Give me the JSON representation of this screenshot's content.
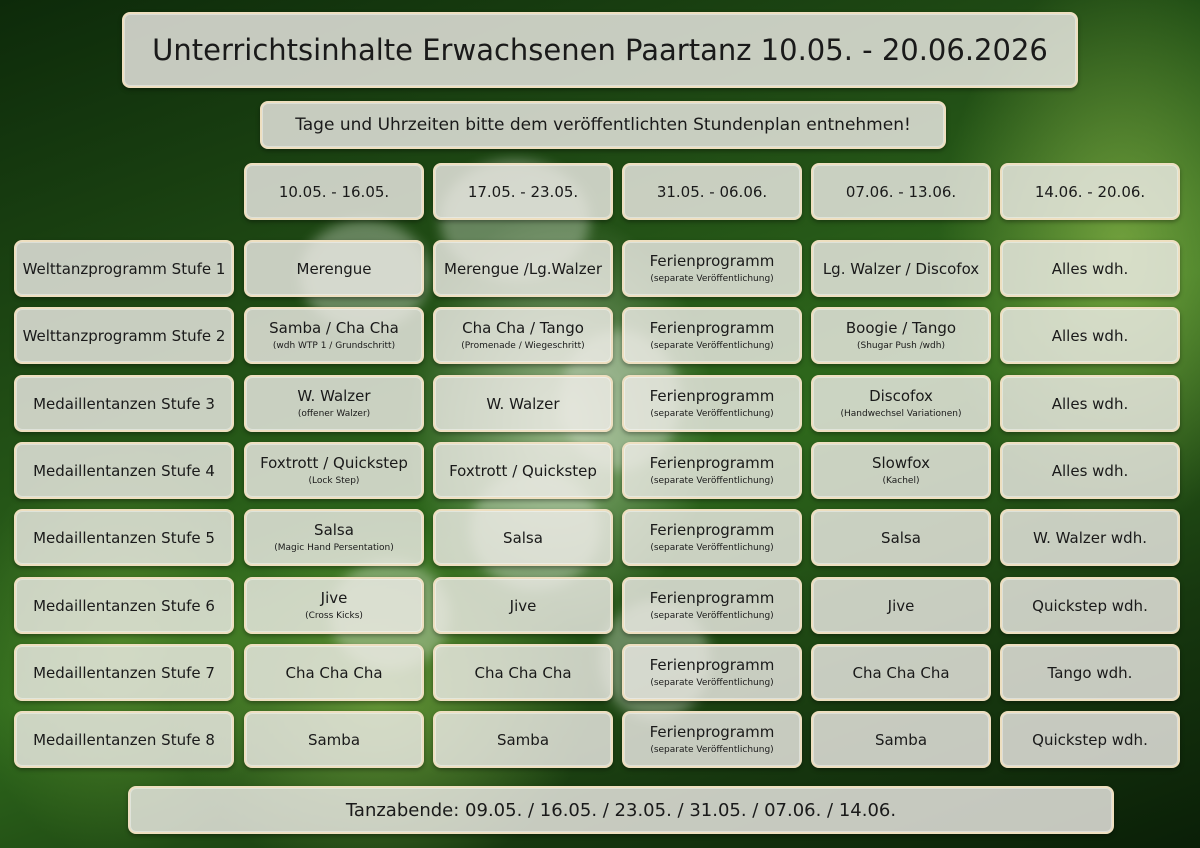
{
  "title": "Unterrichtsinhalte Erwachsenen Paartanz 10.05. - 20.06.2026",
  "subtitle": "Tage und Uhrzeiten bitte dem veröffentlichten Stundenplan entnehmen!",
  "columns": [
    "10.05. - 16.05.",
    "17.05. - 23.05.",
    "31.05. - 06.06.",
    "07.06. - 13.06.",
    "14.06. - 20.06."
  ],
  "rows": [
    {
      "label": "Welttanzprogramm Stufe 1",
      "cells": [
        {
          "main": "Merengue",
          "sub": ""
        },
        {
          "main": "Merengue /Lg.Walzer",
          "sub": ""
        },
        {
          "main": "Ferienprogramm",
          "sub": "(separate Veröffentlichung)"
        },
        {
          "main": "Lg. Walzer / Discofox",
          "sub": ""
        },
        {
          "main": "Alles wdh.",
          "sub": ""
        }
      ]
    },
    {
      "label": "Welttanzprogramm Stufe 2",
      "cells": [
        {
          "main": "Samba / Cha Cha",
          "sub": "(wdh WTP 1 / Grundschritt)"
        },
        {
          "main": "Cha Cha / Tango",
          "sub": "(Promenade / Wiegeschritt)"
        },
        {
          "main": "Ferienprogramm",
          "sub": "(separate Veröffentlichung)"
        },
        {
          "main": "Boogie / Tango",
          "sub": "(Shugar Push /wdh)"
        },
        {
          "main": "Alles wdh.",
          "sub": ""
        }
      ]
    },
    {
      "label": "Medaillentanzen Stufe 3",
      "cells": [
        {
          "main": "W. Walzer",
          "sub": "(offener Walzer)"
        },
        {
          "main": "W. Walzer",
          "sub": ""
        },
        {
          "main": "Ferienprogramm",
          "sub": "(separate Veröffentlichung)"
        },
        {
          "main": "Discofox",
          "sub": "(Handwechsel Variationen)"
        },
        {
          "main": "Alles wdh.",
          "sub": ""
        }
      ]
    },
    {
      "label": "Medaillentanzen Stufe 4",
      "cells": [
        {
          "main": "Foxtrott / Quickstep",
          "sub": "(Lock Step)"
        },
        {
          "main": "Foxtrott / Quickstep",
          "sub": ""
        },
        {
          "main": "Ferienprogramm",
          "sub": "(separate Veröffentlichung)"
        },
        {
          "main": "Slowfox",
          "sub": "(Kachel)"
        },
        {
          "main": "Alles wdh.",
          "sub": ""
        }
      ]
    },
    {
      "label": "Medaillentanzen Stufe 5",
      "cells": [
        {
          "main": "Salsa",
          "sub": "(Magic Hand Persentation)"
        },
        {
          "main": "Salsa",
          "sub": ""
        },
        {
          "main": "Ferienprogramm",
          "sub": "(separate Veröffentlichung)"
        },
        {
          "main": "Salsa",
          "sub": ""
        },
        {
          "main": "W. Walzer wdh.",
          "sub": ""
        }
      ]
    },
    {
      "label": "Medaillentanzen Stufe 6",
      "cells": [
        {
          "main": "Jive",
          "sub": "(Cross Kicks)"
        },
        {
          "main": "Jive",
          "sub": ""
        },
        {
          "main": "Ferienprogramm",
          "sub": "(separate Veröffentlichung)"
        },
        {
          "main": "Jive",
          "sub": ""
        },
        {
          "main": "Quickstep wdh.",
          "sub": ""
        }
      ]
    },
    {
      "label": "Medaillentanzen Stufe 7",
      "cells": [
        {
          "main": "Cha Cha Cha",
          "sub": ""
        },
        {
          "main": "Cha Cha Cha",
          "sub": ""
        },
        {
          "main": "Ferienprogramm",
          "sub": "(separate Veröffentlichung)"
        },
        {
          "main": "Cha Cha Cha",
          "sub": ""
        },
        {
          "main": "Tango wdh.",
          "sub": ""
        }
      ]
    },
    {
      "label": "Medaillentanzen Stufe 8",
      "cells": [
        {
          "main": "Samba",
          "sub": ""
        },
        {
          "main": "Samba",
          "sub": ""
        },
        {
          "main": "Ferienprogramm",
          "sub": "(separate Veröffentlichung)"
        },
        {
          "main": "Samba",
          "sub": ""
        },
        {
          "main": "Quickstep wdh.",
          "sub": ""
        }
      ]
    }
  ],
  "footer": "Tanzabende: 09.05. / 16.05. / 23.05. / 31.05. / 07.06. / 14.06."
}
